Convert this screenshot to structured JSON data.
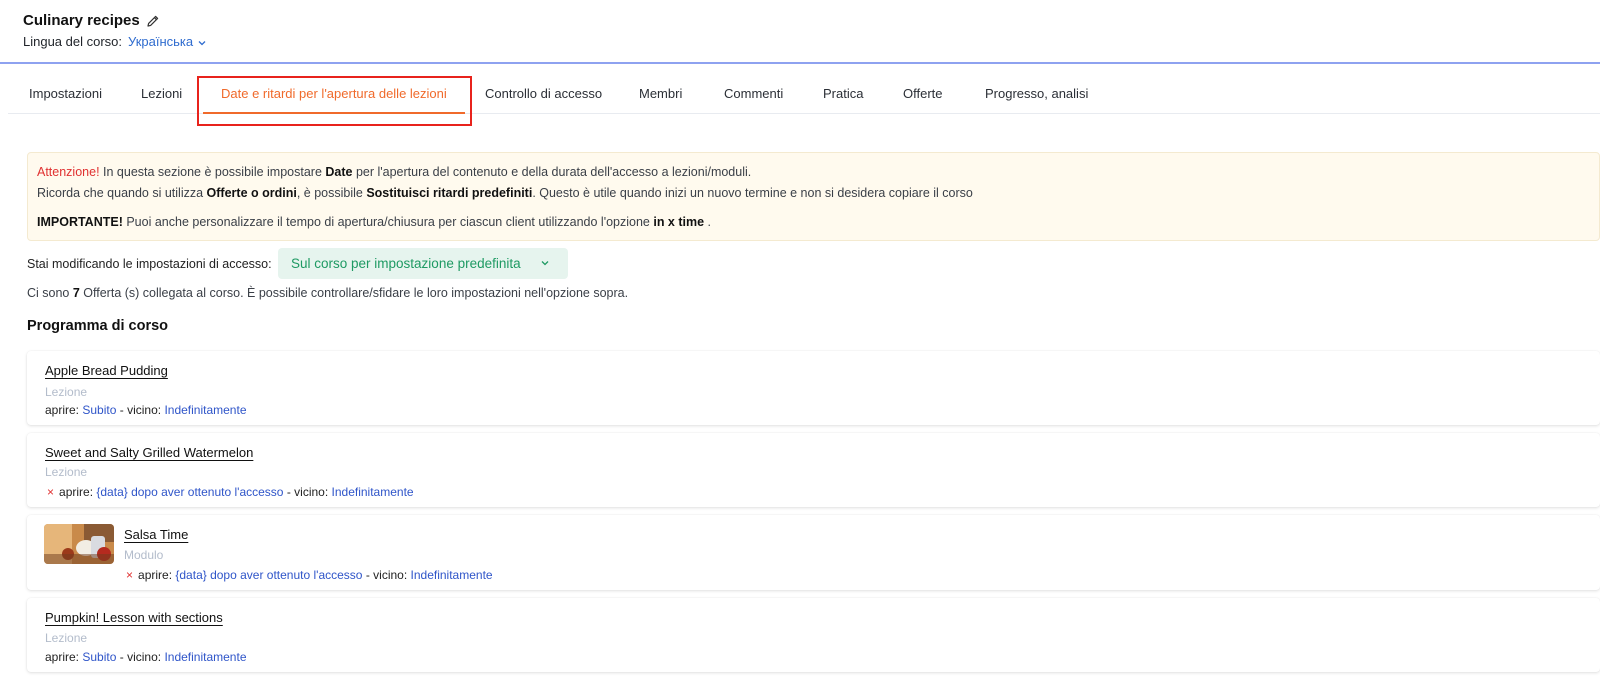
{
  "header": {
    "course_title": "Culinary recipes",
    "language_label": "Lingua del corso:",
    "language_value": "Українська"
  },
  "tabs": [
    {
      "label": "Impostazioni"
    },
    {
      "label": "Lezioni"
    },
    {
      "label": "Date e ritardi per l'apertura delle lezioni",
      "active": true
    },
    {
      "label": "Controllo di accesso"
    },
    {
      "label": "Membri"
    },
    {
      "label": "Commenti"
    },
    {
      "label": "Pratica"
    },
    {
      "label": "Offerte"
    },
    {
      "label": "Progresso, analisi"
    }
  ],
  "notice": {
    "l1_warn": "Attenzione!",
    "l1_a": " In questa sezione è possibile impostare ",
    "l1_b": "Date",
    "l1_c": " per l'apertura del contenuto e della durata dell'accesso a lezioni/moduli.",
    "l2_a": "Ricorda che quando si utilizza ",
    "l2_b": "Offerte o ordini",
    "l2_c": ", è possibile ",
    "l2_d": "Sostituisci ritardi predefiniti",
    "l2_e": ". Questo è utile quando inizi un nuovo termine e non si desidera copiare il corso",
    "l3_a": "IMPORTANTE!",
    "l3_b": " Puoi anche personalizzare il tempo di apertura/chiusura per ciascun client utilizzando l'opzione ",
    "l3_c": "in x time",
    "l3_d": " ."
  },
  "access": {
    "label": "Stai modificando le impostazioni di accesso:",
    "selected": "Sul corso per impostazione predefinita"
  },
  "offers_info": {
    "a": "Ci sono ",
    "count": "7",
    "b": " Offerta (s) collegata al corso. È possibile controllare/sfidare le loro impostazioni nell'opzione sopra."
  },
  "program": {
    "title": "Programma di corso",
    "open_label": "aprire:",
    "close_label": "vicino:",
    "separator": "-",
    "items": [
      {
        "name": "Apple Bread Pudding",
        "type": "Lezione",
        "open": "Subito",
        "close": "Indefinitamente",
        "flag": ""
      },
      {
        "name": "Sweet and Salty Grilled Watermelon",
        "type": "Lezione",
        "open": "{data} dopo aver ottenuto l'accesso",
        "close": "Indefinitamente",
        "flag": "×"
      },
      {
        "name": "Salsa Time",
        "type": "Modulo",
        "open": "{data} dopo aver ottenuto l'accesso",
        "close": "Indefinitamente",
        "flag": "×"
      },
      {
        "name": "Pumpkin! Lesson with sections",
        "type": "Lezione",
        "open": "Subito",
        "close": "Indefinitamente",
        "flag": ""
      }
    ]
  },
  "colors": {
    "accent": "#f06a2b",
    "link": "#2f55c9",
    "select_bg": "#e6f4ee",
    "select_text": "#1e9a63",
    "highlight": "#e8231c"
  }
}
